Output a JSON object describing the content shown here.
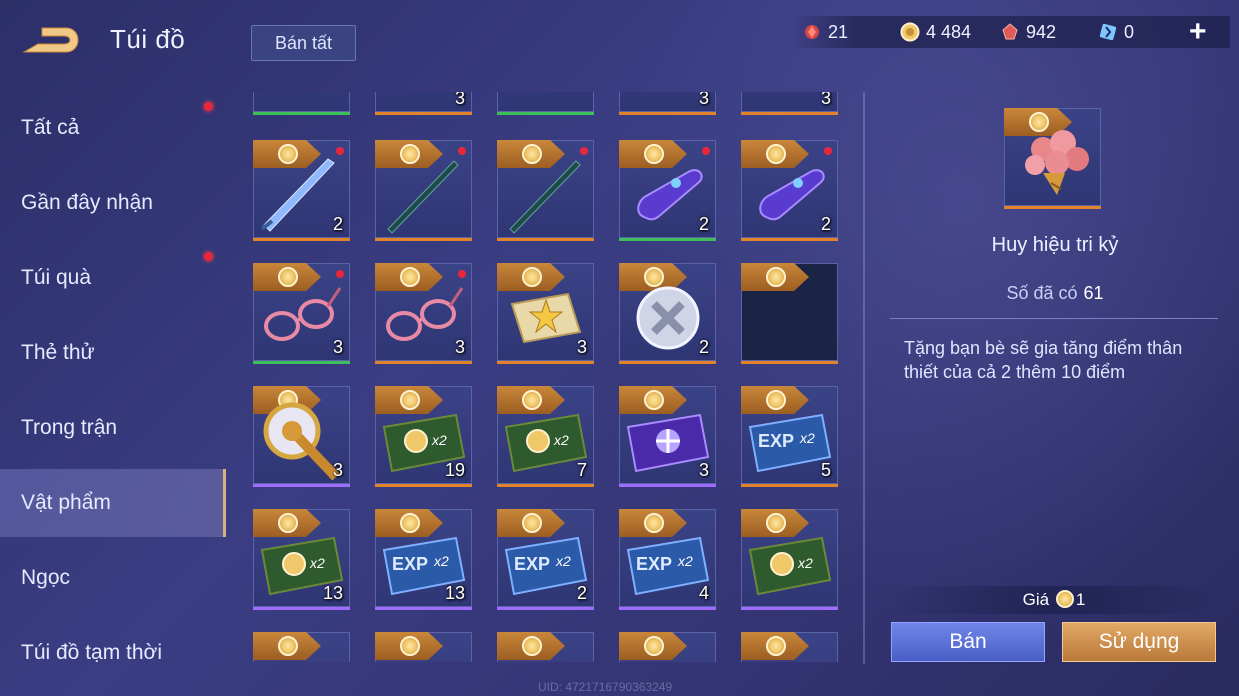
{
  "header": {
    "title": "Túi đồ",
    "sell_all": "Bán tất",
    "currencies": [
      {
        "icon": "red-gem-icon",
        "value": "21"
      },
      {
        "icon": "gold-coin-icon",
        "value": "4 484"
      },
      {
        "icon": "ruby-icon",
        "value": "942"
      },
      {
        "icon": "blue-crystal-icon",
        "value": "0"
      }
    ],
    "plus": "+"
  },
  "sidebar": {
    "items": [
      {
        "label": "Tất cả",
        "dot": true
      },
      {
        "label": "Gần đây nhận",
        "dot": false
      },
      {
        "label": "Túi quà",
        "dot": true
      },
      {
        "label": "Thẻ thử",
        "dot": false
      },
      {
        "label": "Trong trận",
        "dot": false
      },
      {
        "label": "Vật phẩm",
        "dot": false,
        "active": true
      },
      {
        "label": "Ngọc",
        "dot": false
      },
      {
        "label": "Túi đồ tạm thời",
        "dot": false
      }
    ]
  },
  "grid": {
    "rows": [
      [
        {
          "art": "partial",
          "count": "",
          "bar": "green"
        },
        {
          "art": "partial",
          "count": "3",
          "bar": "orange"
        },
        {
          "art": "partial-sword",
          "count": "",
          "bar": "green"
        },
        {
          "art": "partial",
          "count": "3",
          "bar": "orange"
        },
        {
          "art": "partial",
          "count": "3",
          "bar": "orange"
        }
      ],
      [
        {
          "art": "blue-sword-icon",
          "count": "2",
          "bar": "orange",
          "dot": true
        },
        {
          "art": "dark-sword-icon",
          "count": "",
          "bar": "orange",
          "dot": true
        },
        {
          "art": "dark-sword-icon",
          "count": "",
          "bar": "orange",
          "dot": true
        },
        {
          "art": "headset-icon",
          "count": "2",
          "bar": "green",
          "dot": true
        },
        {
          "art": "headset-icon",
          "count": "2",
          "bar": "orange",
          "dot": true
        }
      ],
      [
        {
          "art": "glasses-icon",
          "count": "3",
          "bar": "green",
          "dot": true
        },
        {
          "art": "glasses-icon",
          "count": "3",
          "bar": "orange",
          "dot": true
        },
        {
          "art": "star-ticket-icon",
          "count": "3",
          "bar": "orange"
        },
        {
          "art": "silver-badge-icon",
          "count": "2",
          "bar": "orange"
        },
        {
          "art": "empty-dark",
          "count": "",
          "bar": "orange"
        }
      ],
      [
        {
          "art": "gold-horn-icon",
          "count": "3",
          "bar": "purple"
        },
        {
          "art": "gold-x2-card-icon",
          "count": "19",
          "bar": "orange"
        },
        {
          "art": "gold-x2-card-icon",
          "count": "7",
          "bar": "orange"
        },
        {
          "art": "purple-card-icon",
          "count": "3",
          "bar": "purple"
        },
        {
          "art": "exp-x2-card-icon",
          "count": "5",
          "bar": "orange"
        }
      ],
      [
        {
          "art": "gold-x2-card-icon",
          "count": "13",
          "bar": "purple"
        },
        {
          "art": "exp-x2-card-icon",
          "count": "13",
          "bar": "purple"
        },
        {
          "art": "exp-x2-card-icon",
          "count": "2",
          "bar": "purple"
        },
        {
          "art": "exp-x2-card-icon",
          "count": "4",
          "bar": "purple"
        },
        {
          "art": "gold-x2-card-icon",
          "count": "",
          "bar": "purple"
        }
      ],
      [
        {
          "art": "partial",
          "count": "",
          "bar": ""
        },
        {
          "art": "partial",
          "count": "",
          "bar": ""
        },
        {
          "art": "partial",
          "count": "",
          "bar": ""
        },
        {
          "art": "partial",
          "count": "",
          "bar": ""
        },
        {
          "art": "partial",
          "count": "",
          "bar": ""
        }
      ]
    ]
  },
  "detail": {
    "name": "Huy hiệu tri kỷ",
    "owned_label": "Số đã có",
    "owned_value": "61",
    "description": "Tặng bạn bè sẽ gia tăng điểm thân thiết của cả 2 thêm 10 điểm",
    "price_label": "Giá",
    "price_value": "1",
    "sell_button": "Bán",
    "use_button": "Sử dụng"
  },
  "uid": "UID: 4721716790363249",
  "colors": {
    "accent_gold": "#d8b27a",
    "bar_orange": "#e0832a",
    "bar_green": "#3fbf5a",
    "bar_purple": "#a06bff",
    "notification_red": "#e8283a"
  }
}
